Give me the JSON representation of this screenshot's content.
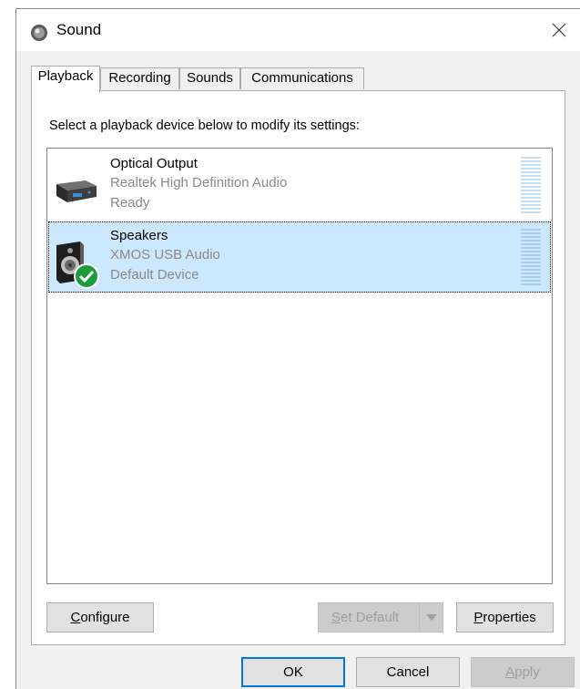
{
  "window": {
    "title": "Sound",
    "icon": "speaker-icon"
  },
  "tabs": [
    {
      "label": "Playback",
      "active": true
    },
    {
      "label": "Recording",
      "active": false
    },
    {
      "label": "Sounds",
      "active": false
    },
    {
      "label": "Communications",
      "active": false
    }
  ],
  "instructions": "Select a playback device below to modify its settings:",
  "devices": [
    {
      "name": "Optical Output",
      "driver": "Realtek High Definition Audio",
      "status": "Ready",
      "selected": false,
      "icon": "optical-output-icon"
    },
    {
      "name": "Speakers",
      "driver": "XMOS USB Audio",
      "status": "Default Device",
      "selected": true,
      "icon": "speakers-icon",
      "badge": "default-check-icon"
    }
  ],
  "panel_buttons": {
    "configure": {
      "label": "Configure",
      "accel": "C",
      "rest": "onfigure"
    },
    "set_default": {
      "label": "Set Default",
      "accel": "S",
      "rest": "et Default",
      "disabled": true
    },
    "properties": {
      "label": "Properties",
      "accel": "P",
      "rest": "roperties"
    }
  },
  "dialog_buttons": {
    "ok": "OK",
    "cancel": "Cancel",
    "apply": {
      "label": "Apply",
      "accel": "A",
      "rest": "pply",
      "disabled": true
    }
  },
  "colors": {
    "selection": "#cce8ff",
    "accent": "#0078d7",
    "check": "#1e9b3c"
  }
}
